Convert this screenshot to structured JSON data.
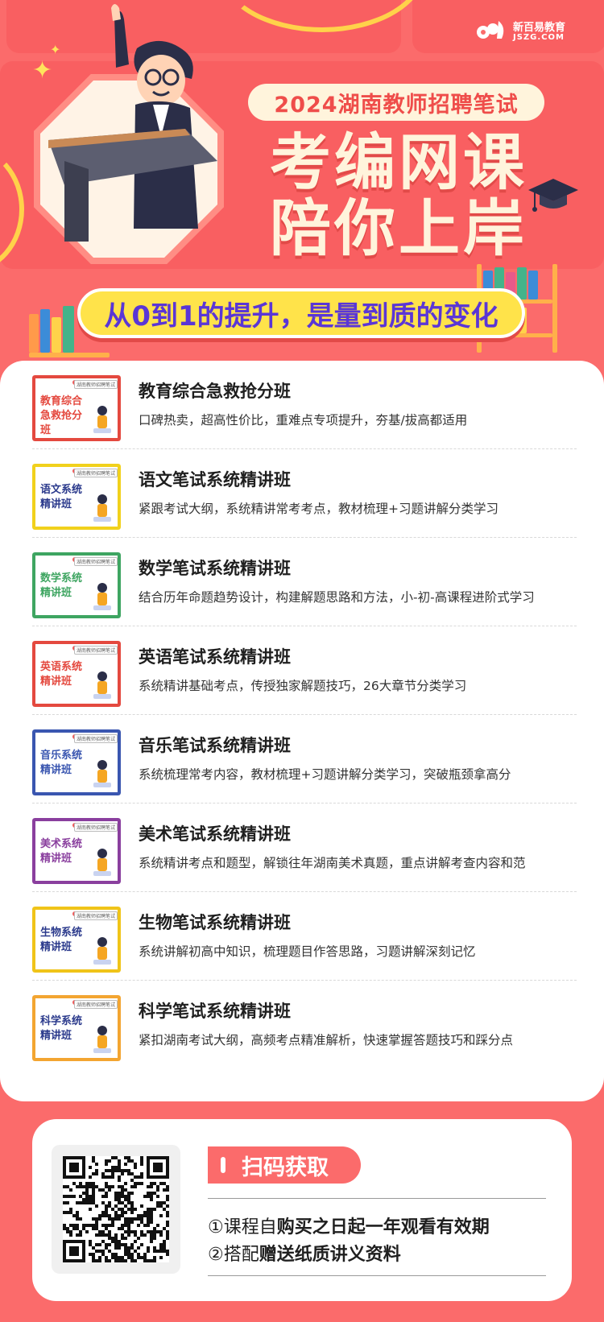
{
  "brand": {
    "logo_cn": "新百易教育",
    "logo_en": "JSZG.COM"
  },
  "hero": {
    "year_title": "2024湖南教师招聘笔试",
    "headline_line1": "考编网课",
    "headline_line2": "陪你上岸",
    "slogan": "从0到1的提升，是量到质的变化"
  },
  "courses": [
    {
      "title": "教育综合急救抢分班",
      "desc": "口碑热卖，超高性价比，重难点专项提升，夯基/拔高都适用",
      "thumb_line1": "教育综合",
      "thumb_line2": "急救抢分班",
      "thumb_tag": "湖南教师招聘笔试",
      "accent": "#e4493f"
    },
    {
      "title": "语文笔试系统精讲班",
      "desc": "紧跟考试大纲，系统精讲常考考点，教材梳理+习题讲解分类学习",
      "thumb_line1": "语文系统",
      "thumb_line2": "精讲班",
      "thumb_tag": "湖南教师招聘笔试",
      "accent": "#f1d11c"
    },
    {
      "title": "数学笔试系统精讲班",
      "desc": "结合历年命题趋势设计，构建解题思路和方法，小-初-高课程进阶式学习",
      "thumb_line1": "数学系统",
      "thumb_line2": "精讲班",
      "thumb_tag": "湖南教师招聘笔试",
      "accent": "#3ea561"
    },
    {
      "title": "英语笔试系统精讲班",
      "desc": "系统精讲基础考点，传授独家解题技巧，26大章节分类学习",
      "thumb_line1": "英语系统",
      "thumb_line2": "精讲班",
      "thumb_tag": "湖南教师招聘笔试",
      "accent": "#e4493f"
    },
    {
      "title": "音乐笔试系统精讲班",
      "desc": "系统梳理常考内容，教材梳理+习题讲解分类学习，突破瓶颈拿高分",
      "thumb_line1": "音乐系统",
      "thumb_line2": "精讲班",
      "thumb_tag": "湖南教师招聘笔试",
      "accent": "#3a56b0"
    },
    {
      "title": "美术笔试系统精讲班",
      "desc": "系统精讲考点和题型，解锁往年湖南美术真题，重点讲解考查内容和范",
      "thumb_line1": "美术系统",
      "thumb_line2": "精讲班",
      "thumb_tag": "湖南教师招聘笔试",
      "accent": "#8a3f9e"
    },
    {
      "title": "生物笔试系统精讲班",
      "desc": "系统讲解初高中知识，梳理题目作答思路，习题讲解深刻记忆",
      "thumb_line1": "生物系统",
      "thumb_line2": "精讲班",
      "thumb_tag": "湖南教师招聘笔试",
      "accent": "#f0c419"
    },
    {
      "title": "科学笔试系统精讲班",
      "desc": "紧扣湖南考试大纲，高频考点精准解析，快速掌握答题技巧和踩分点",
      "thumb_line1": "科学系统",
      "thumb_line2": "精讲班",
      "thumb_tag": "湖南教师招聘笔试",
      "accent": "#f3a531"
    }
  ],
  "footer": {
    "scan_label": "扫码获取",
    "benefit1_prefix": "①课程自",
    "benefit1_strong": "购买之日起一年观看有效期",
    "benefit2_prefix": "②搭配",
    "benefit2_strong": "赠送纸质讲义资料"
  },
  "colors": {
    "background": "#fb6b6b",
    "headline": "#fff4dc",
    "slogan_bg": "#ffe34a",
    "slogan_text": "#5a36d6"
  }
}
